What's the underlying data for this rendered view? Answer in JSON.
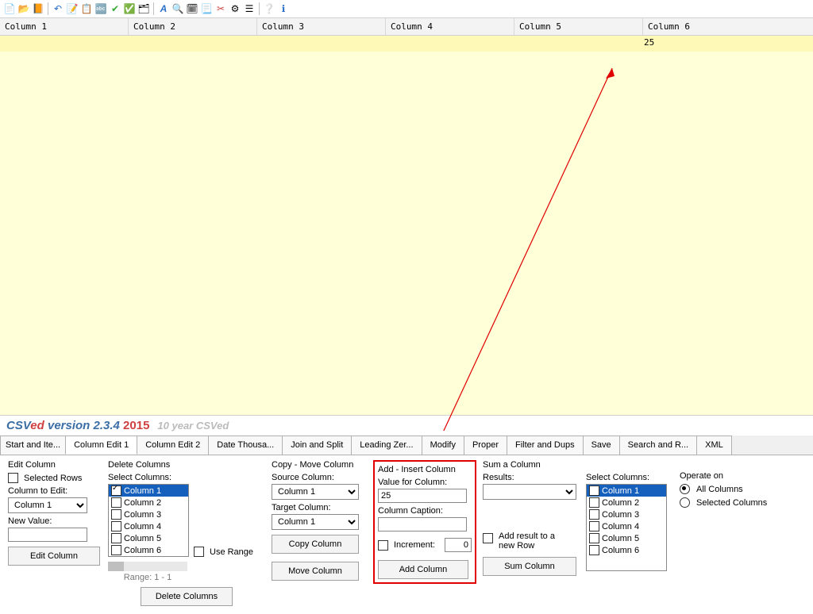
{
  "toolbar_icons": [
    "new",
    "open",
    "book",
    "",
    "undo",
    "edit",
    "highlight",
    "find",
    "check",
    "shield",
    "menu",
    "",
    "font",
    "zoom",
    "calendar",
    "page",
    "tools",
    "gear",
    "list",
    "",
    "help",
    "info"
  ],
  "grid": {
    "headers": [
      "Column 1",
      "Column 2",
      "Column 3",
      "Column 4",
      "Column 5",
      "Column 6"
    ],
    "row": [
      "",
      "",
      "",
      "",
      "",
      "25"
    ]
  },
  "version": {
    "a": "CSV",
    "b": "ed",
    "c": " version 2.3.4",
    "d": " 2015",
    "e": "10 year CSVed"
  },
  "tabs": [
    "Start and Ite...",
    "Column Edit 1",
    "Column Edit 2",
    "Date Thousa...",
    "Join and Split",
    "Leading Zer...",
    "Modify",
    "Proper",
    "Filter and Dups",
    "Save",
    "Search and R...",
    "XML"
  ],
  "active_tab": 1,
  "edit_col": {
    "legend": "Edit Column",
    "selected_rows": "Selected Rows",
    "col_to_edit": "Column to Edit:",
    "col_val": "Column 1",
    "new_value": "New Value:",
    "btn": "Edit Column"
  },
  "del_cols": {
    "legend": "Delete Columns",
    "select": "Select Columns:",
    "list": [
      "Column 1",
      "Column 2",
      "Column 3",
      "Column 4",
      "Column 5",
      "Column 6"
    ],
    "use_range": "Use Range",
    "range": "Range:  1 - 1",
    "btn": "Delete Columns"
  },
  "copy_move": {
    "legend": "Copy - Move Column",
    "source": "Source Column:",
    "source_val": "Column 1",
    "target": "Target Column:",
    "target_val": "Column 1",
    "copy_btn": "Copy Column",
    "move_btn": "Move Column"
  },
  "add_col": {
    "legend": "Add - Insert Column",
    "value": "Value for Column:",
    "value_val": "25",
    "caption": "Column Caption:",
    "caption_val": "",
    "increment": "Increment:",
    "increment_val": "0",
    "btn": "Add Column"
  },
  "sum_col": {
    "legend": "Sum a Column",
    "results": "Results:",
    "add_result": "Add result to a new Row",
    "btn": "Sum Column",
    "select": "Select Columns:",
    "list": [
      "Column 1",
      "Column 2",
      "Column 3",
      "Column 4",
      "Column 5",
      "Column 6"
    ]
  },
  "operate": {
    "legend": "Operate on",
    "all": "All Columns",
    "sel": "Selected Columns"
  }
}
